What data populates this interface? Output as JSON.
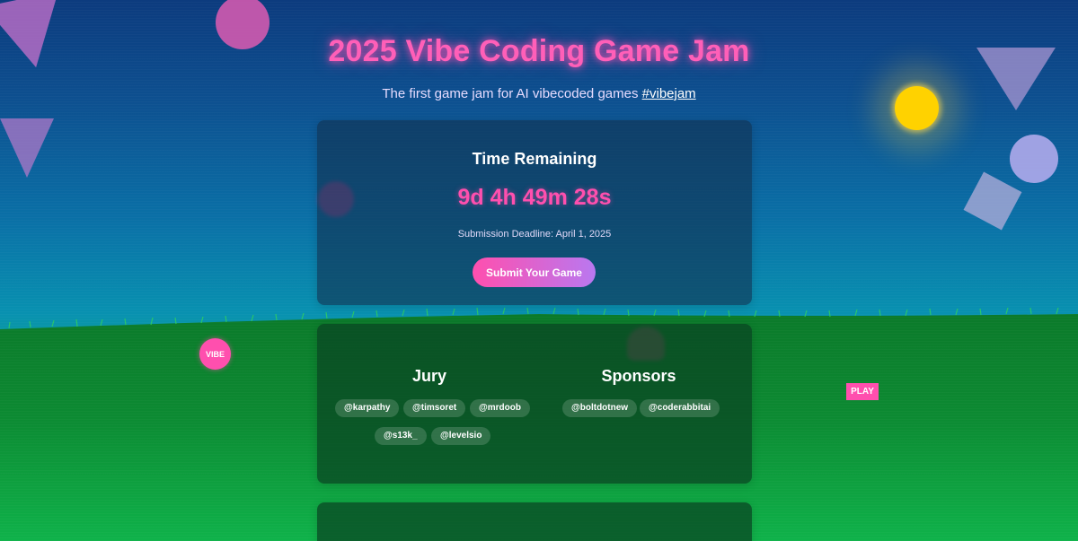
{
  "header": {
    "title": "2025 Vibe Coding Game Jam",
    "subtitle_text": "The first game jam for AI vibecoded games",
    "hashtag": "#vibejam"
  },
  "timer": {
    "heading": "Time Remaining",
    "countdown": "9d 4h 49m 28s",
    "deadline": "Submission Deadline: April 1, 2025",
    "submit_label": "Submit Your Game"
  },
  "jury": {
    "heading": "Jury",
    "members": [
      "@karpathy",
      "@timsoret",
      "@mrdoob",
      "@s13k_",
      "@levelsio"
    ]
  },
  "sponsors": {
    "heading": "Sponsors",
    "members": [
      "@boltdotnew",
      "@coderabbitai"
    ]
  },
  "badges": {
    "vibe": "VIBE",
    "play": "PLAY"
  },
  "colors": {
    "accent_pink": "#ff4fae",
    "sky_top": "#0c3b7e",
    "sky_bottom": "#0a9aa0",
    "grass": "#0f8f35",
    "sun": "#ffd200"
  }
}
